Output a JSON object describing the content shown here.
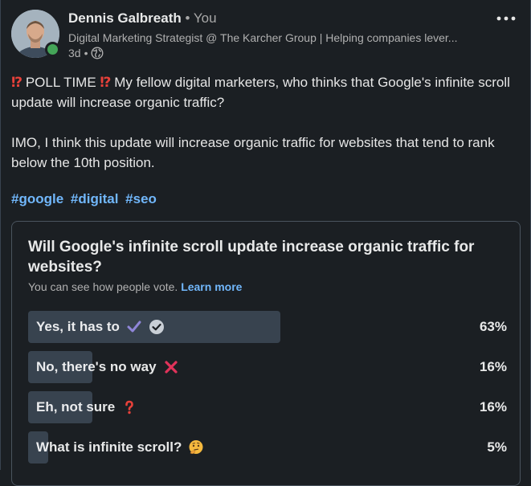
{
  "author": {
    "name": "Dennis Galbreath",
    "separator": "•",
    "relation": "You",
    "headline": "Digital Marketing Strategist @ The Karcher Group | Helping companies lever...",
    "age": "3d",
    "age_separator": "•",
    "visibility_icon": "globe-icon",
    "presence": "online"
  },
  "menu": {
    "more_icon": "ellipsis-icon"
  },
  "post": {
    "line1_emoji_left": "⁉",
    "line1_prefix": " POLL TIME ",
    "line1_emoji_right": "⁉",
    "line1_rest": " My fellow digital marketers, who thinks that Google's infinite scroll update will increase organic traffic?",
    "line2": "IMO, I think this update will increase organic traffic for websites that tend to rank below the 10th position.",
    "hashtags": [
      "#google",
      "#digital",
      "#seo"
    ]
  },
  "poll": {
    "question": "Will Google's infinite scroll update increase organic traffic for websites?",
    "note": "You can see how people vote.",
    "learn_more": "Learn more",
    "options": [
      {
        "label": "Yes, it has to",
        "percent_text": "63%",
        "percent": 63,
        "emoji": "purple-check-icon",
        "selected_icon": "selected-check-icon"
      },
      {
        "label": "No, there's no way",
        "percent_text": "16%",
        "percent": 16,
        "emoji": "red-x-icon"
      },
      {
        "label": "Eh, not sure",
        "percent_text": "16%",
        "percent": 16,
        "emoji": "red-question-icon"
      },
      {
        "label": "What is infinite scroll?",
        "percent_text": "5%",
        "percent": 5,
        "emoji": "thinking-face-icon"
      }
    ]
  },
  "colors": {
    "background": "#1b1f23",
    "link": "#71b7fb",
    "bar_fill": "#38434f",
    "presence": "#44a558",
    "emoji_red": "#e8413a"
  }
}
